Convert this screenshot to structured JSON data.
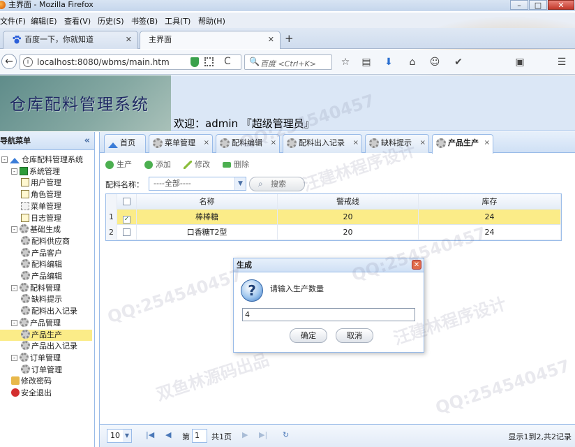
{
  "window": {
    "title": "主界面 - Mozilla Firefox",
    "min": "–",
    "max": "□",
    "close": "✕"
  },
  "menubar": [
    "文件(F)",
    "编辑(E)",
    "查看(V)",
    "历史(S)",
    "书签(B)",
    "工具(T)",
    "帮助(H)"
  ],
  "browser_tabs": [
    {
      "label": "百度一下，你就知道",
      "close": "✕"
    },
    {
      "label": "主界面",
      "close": "✕"
    }
  ],
  "newtab": "+",
  "navbar": {
    "back": "←",
    "info": "i",
    "url": "localhost:8080/wbms/main.htm",
    "reload": "C",
    "search_placeholder": "百度 <Ctrl+K>",
    "search_icon": "🔍",
    "icons": [
      "star-icon",
      "reader-icon",
      "download-icon",
      "home-icon",
      "smiley-icon",
      "pocket-icon",
      "puzzle-icon",
      "menu-icon"
    ],
    "icon_glyphs": [
      "☆",
      "▤",
      "⬇",
      "⌂",
      "☺",
      "✔",
      "▣",
      "☰"
    ]
  },
  "app": {
    "title": "仓库配料管理系统",
    "welcome": "欢迎：admin 『超级管理员』"
  },
  "leftnav": {
    "header": "导航菜单",
    "collapse": "«",
    "tree": [
      {
        "label": "仓库配料管理系统",
        "icon": "home",
        "level": 0,
        "toggle": "-"
      },
      {
        "label": "系统管理",
        "icon": "book",
        "level": 1,
        "toggle": "-"
      },
      {
        "label": "用户管理",
        "icon": "doc",
        "level": 2
      },
      {
        "label": "角色管理",
        "icon": "doc",
        "level": 2
      },
      {
        "label": "菜单管理",
        "icon": "menu",
        "level": 2
      },
      {
        "label": "日志管理",
        "icon": "doc",
        "level": 2
      },
      {
        "label": "基础生成",
        "icon": "gear",
        "level": 1,
        "toggle": "-"
      },
      {
        "label": "配料供应商",
        "icon": "gear",
        "level": 2
      },
      {
        "label": "产品客户",
        "icon": "gear",
        "level": 2
      },
      {
        "label": "配料编辑",
        "icon": "gear",
        "level": 2
      },
      {
        "label": "产品编辑",
        "icon": "gear",
        "level": 2
      },
      {
        "label": "配料管理",
        "icon": "gear",
        "level": 1,
        "toggle": "-"
      },
      {
        "label": "缺料提示",
        "icon": "gear",
        "level": 2
      },
      {
        "label": "配料出入记录",
        "icon": "gear",
        "level": 2
      },
      {
        "label": "产品管理",
        "icon": "gear",
        "level": 1,
        "toggle": "-"
      },
      {
        "label": "产品生产",
        "icon": "gear",
        "level": 2,
        "selected": true
      },
      {
        "label": "产品出入记录",
        "icon": "gear",
        "level": 2
      },
      {
        "label": "订单管理",
        "icon": "gear",
        "level": 1,
        "toggle": "-"
      },
      {
        "label": "订单管理",
        "icon": "gear",
        "level": 2
      },
      {
        "label": "修改密码",
        "icon": "key",
        "level": 1
      },
      {
        "label": "安全退出",
        "icon": "exit",
        "level": 1
      }
    ]
  },
  "content_tabs": [
    {
      "label": "首页",
      "closable": false
    },
    {
      "label": "菜单管理",
      "closable": true
    },
    {
      "label": "配料编辑",
      "closable": true
    },
    {
      "label": "配料出入记录",
      "closable": true
    },
    {
      "label": "缺料提示",
      "closable": true
    },
    {
      "label": "产品生产",
      "closable": true,
      "active": true
    }
  ],
  "tab_close": "×",
  "toolbar": {
    "produce": "生产",
    "add": "添加",
    "edit": "修改",
    "delete": "删除"
  },
  "filter": {
    "label": "配料名称：",
    "select_value": "----全部----",
    "search": "搜索",
    "arrow": "▼"
  },
  "grid": {
    "columns": [
      "名称",
      "警戒线",
      "库存"
    ],
    "rows": [
      {
        "num": "1",
        "checked": true,
        "name": "棒棒糖",
        "warn": "20",
        "stock": "24"
      },
      {
        "num": "2",
        "checked": false,
        "name": "口香糖T2型",
        "warn": "20",
        "stock": "24"
      }
    ],
    "check_mark": "✓"
  },
  "pager": {
    "page_size": "10",
    "first": "|◀",
    "prev": "◀",
    "page_label": "第",
    "page": "1",
    "total_label": "共1页",
    "next": "▶",
    "last": "▶|",
    "refresh": "↻",
    "info": "显示1到2,共2记录"
  },
  "dialog": {
    "title": "生成",
    "close": "✕",
    "icon": "?",
    "message": "请输入生产数量",
    "value": "4",
    "ok": "确定",
    "cancel": "取消"
  },
  "watermarks": [
    "QQ:254540457",
    "汪建林程序设计",
    "双鱼林源码出品"
  ]
}
